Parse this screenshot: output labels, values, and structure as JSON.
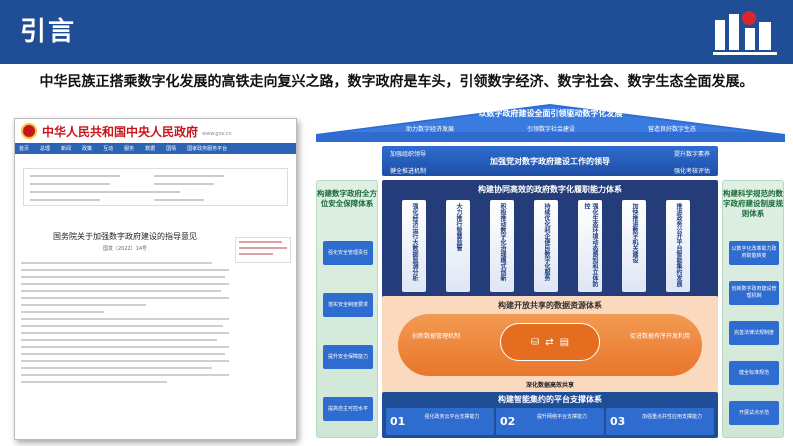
{
  "header": {
    "title": "引言"
  },
  "subtitle": "中华民族正搭乘数字化发展的高铁走向复兴之路，数字政府是车头，引领数字经济、数字社会、数字生态全面发展。",
  "document": {
    "site_name": "中华人民共和国中央人民政府",
    "site_url": "www.gov.cn",
    "nav": [
      "首页",
      "总理",
      "新闻",
      "政策",
      "互动",
      "服务",
      "数据",
      "国情",
      "国家政务服务平台"
    ],
    "title": "国务院关于加强数字政府建设的指导意见",
    "doc_number": "国发〔2022〕14号",
    "side_title": "国务院关于加强数字政府建设的指导意见"
  },
  "diagram": {
    "roof_title": "以数字政府建设全面引领驱动数字化发展",
    "roof_items": [
      "助力数字经济发展",
      "引领数字社会建设",
      "营造良好数字生态"
    ],
    "lead": {
      "tl1": "加强组织领导",
      "tl2": "健全推进机制",
      "tr1": "提升数字素养",
      "tr2": "强化考核评估",
      "main": "加强党对数字政府建设工作的领导"
    },
    "left_pillar": {
      "title": "构建数字政府全方位安全保障体系",
      "items": [
        "强化安全管理责任",
        "落实安全制度要求",
        "提升安全保障能力",
        "提高自主可控水平"
      ]
    },
    "right_pillar": {
      "title": "构建科学规范的数字政府建设制度规则体系",
      "items": [
        "以数字化改革助力政府职能转变",
        "创新数字政府建设管理机制",
        "完善法律法规制度",
        "健全标准规范",
        "开展试点示范"
      ]
    },
    "func": {
      "title": "构建协同高效的政府数字化履职能力体系",
      "cols": [
        "强化经济运行大数据监测分析",
        "大力推行智慧监管",
        "积极推动数字化治理模式创新",
        "持续优化利企便民数字化服务",
        "强化生态环境动态感知和立体防控",
        "加快推进数字机关建设",
        "推进政务公开平台智能集约发展"
      ]
    },
    "data": {
      "title": "构建开放共享的数据资源体系",
      "left": "创新数据管理机制",
      "right": "促进数据有序开发利用",
      "bottom": "深化数据高效共享"
    },
    "platform": {
      "title": "构建智能集约的平台支撑体系",
      "items": [
        {
          "num": "01",
          "label": "强化政务云平台支撑能力"
        },
        {
          "num": "02",
          "label": "提升网络平台支撑能力"
        },
        {
          "num": "03",
          "label": "加强重点共性应用支撑能力"
        }
      ]
    }
  }
}
